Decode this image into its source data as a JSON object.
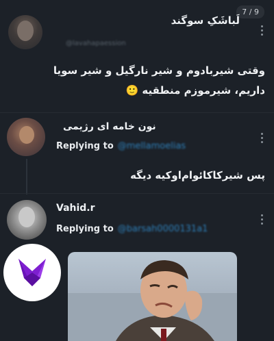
{
  "counter": "7 / 9",
  "tweets": [
    {
      "name": "لَباشَکِ سوگند",
      "handle": "@lavahapaession",
      "text_line1": "وقتی شیربادوم و شیر نارگیل و شیر سویا",
      "text_line2": "داریم، شیرموزم منطقیه 🙂"
    },
    {
      "name": "نون خامه ای رژیمی",
      "reply_label": "Replying to",
      "reply_handle": "@mellamoelias",
      "text": "پس شیرکاکائوام‌اوکیه دیگه"
    },
    {
      "name": "Vahid.r",
      "reply_label": "Replying to",
      "reply_handle": "@barsah0000131a1"
    }
  ],
  "colors": {
    "background": "#1c2128",
    "accent": "#7e1fd0",
    "link": "#2e7fb8"
  }
}
